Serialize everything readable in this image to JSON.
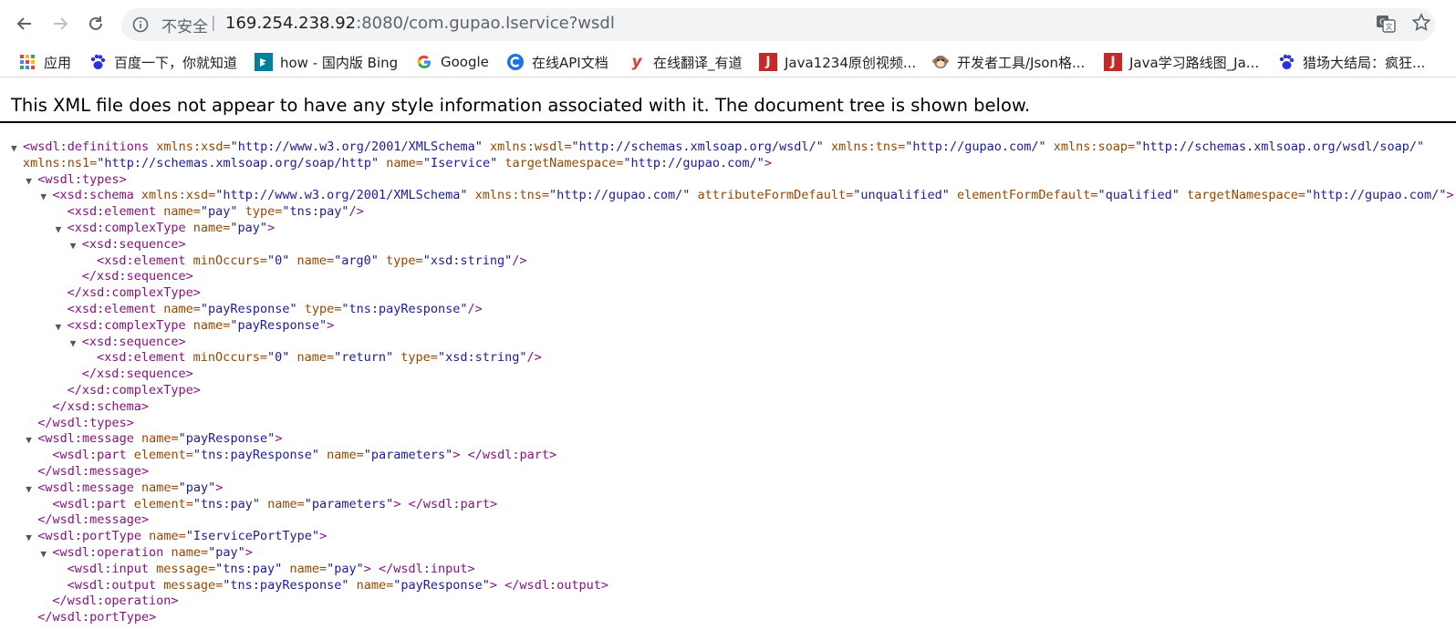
{
  "browser": {
    "insecure_label": "不安全",
    "separator": "|",
    "url_host": "169.254.238.92",
    "url_rest": ":8080/com.gupao.Iservice?wsdl"
  },
  "bookmarks": [
    {
      "label": "应用",
      "icon": "apps-grid-icon"
    },
    {
      "label": "百度一下，你就知道",
      "icon": "baidu-paw-icon"
    },
    {
      "label": "how - 国内版 Bing",
      "icon": "bing-icon"
    },
    {
      "label": "Google",
      "icon": "google-icon"
    },
    {
      "label": "在线API文档",
      "icon": "api-doc-icon"
    },
    {
      "label": "在线翻译_有道",
      "icon": "youdao-icon"
    },
    {
      "label": "Java1234原创视频...",
      "icon": "java1234-icon"
    },
    {
      "label": "开发者工具/Json格...",
      "icon": "monkey-icon"
    },
    {
      "label": "Java学习路线图_Ja...",
      "icon": "java-route-icon"
    },
    {
      "label": "猎场大结局：疯狂...",
      "icon": "baidu-paw-icon"
    }
  ],
  "banner": "This XML file does not appear to have any style information associated with it. The document tree is shown below.",
  "xml_lines": [
    {
      "indent": 0,
      "toggle": true,
      "parts": [
        {
          "t": "tg",
          "v": "<wsdl:definitions"
        },
        {
          "t": "an",
          "v": " xmlns:xsd="
        },
        {
          "t": "av",
          "v": "\"http://www.w3.org/2001/XMLSchema\""
        },
        {
          "t": "an",
          "v": " xmlns:wsdl="
        },
        {
          "t": "av",
          "v": "\"http://schemas.xmlsoap.org/wsdl/\""
        },
        {
          "t": "an",
          "v": " xmlns:tns="
        },
        {
          "t": "av",
          "v": "\"http://gupao.com/\""
        },
        {
          "t": "an",
          "v": " xmlns:soap="
        },
        {
          "t": "av",
          "v": "\"http://schemas.xmlsoap.org/wsdl/soap/\""
        }
      ]
    },
    {
      "indent": 0,
      "toggle": false,
      "cont": true,
      "parts": [
        {
          "t": "an",
          "v": "xmlns:ns1="
        },
        {
          "t": "av",
          "v": "\"http://schemas.xmlsoap.org/soap/http\""
        },
        {
          "t": "an",
          "v": " name="
        },
        {
          "t": "av",
          "v": "\"Iservice\""
        },
        {
          "t": "an",
          "v": " targetNamespace="
        },
        {
          "t": "av",
          "v": "\"http://gupao.com/\""
        },
        {
          "t": "tg",
          "v": ">"
        }
      ]
    },
    {
      "indent": 1,
      "toggle": true,
      "parts": [
        {
          "t": "tg",
          "v": "<wsdl:types>"
        }
      ]
    },
    {
      "indent": 2,
      "toggle": true,
      "parts": [
        {
          "t": "tg",
          "v": "<xsd:schema"
        },
        {
          "t": "an",
          "v": " xmlns:xsd="
        },
        {
          "t": "av",
          "v": "\"http://www.w3.org/2001/XMLSchema\""
        },
        {
          "t": "an",
          "v": " xmlns:tns="
        },
        {
          "t": "av",
          "v": "\"http://gupao.com/\""
        },
        {
          "t": "an",
          "v": " attributeFormDefault="
        },
        {
          "t": "av",
          "v": "\"unqualified\""
        },
        {
          "t": "an",
          "v": " elementFormDefault="
        },
        {
          "t": "av",
          "v": "\"qualified\""
        },
        {
          "t": "an",
          "v": " targetNamespace="
        },
        {
          "t": "av",
          "v": "\"http://gupao.com/\""
        },
        {
          "t": "tg",
          "v": ">"
        }
      ]
    },
    {
      "indent": 3,
      "toggle": false,
      "parts": [
        {
          "t": "tg",
          "v": "<xsd:element"
        },
        {
          "t": "an",
          "v": " name="
        },
        {
          "t": "av",
          "v": "\"pay\""
        },
        {
          "t": "an",
          "v": " type="
        },
        {
          "t": "av",
          "v": "\"tns:pay\""
        },
        {
          "t": "tg",
          "v": "/>"
        }
      ]
    },
    {
      "indent": 3,
      "toggle": true,
      "parts": [
        {
          "t": "tg",
          "v": "<xsd:complexType"
        },
        {
          "t": "an",
          "v": " name="
        },
        {
          "t": "av",
          "v": "\"pay\""
        },
        {
          "t": "tg",
          "v": ">"
        }
      ]
    },
    {
      "indent": 4,
      "toggle": true,
      "parts": [
        {
          "t": "tg",
          "v": "<xsd:sequence>"
        }
      ]
    },
    {
      "indent": 5,
      "toggle": false,
      "parts": [
        {
          "t": "tg",
          "v": "<xsd:element"
        },
        {
          "t": "an",
          "v": " minOccurs="
        },
        {
          "t": "av",
          "v": "\"0\""
        },
        {
          "t": "an",
          "v": " name="
        },
        {
          "t": "av",
          "v": "\"arg0\""
        },
        {
          "t": "an",
          "v": " type="
        },
        {
          "t": "av",
          "v": "\"xsd:string\""
        },
        {
          "t": "tg",
          "v": "/>"
        }
      ]
    },
    {
      "indent": 4,
      "toggle": false,
      "parts": [
        {
          "t": "tg",
          "v": "</xsd:sequence>"
        }
      ]
    },
    {
      "indent": 3,
      "toggle": false,
      "parts": [
        {
          "t": "tg",
          "v": "</xsd:complexType>"
        }
      ]
    },
    {
      "indent": 3,
      "toggle": false,
      "parts": [
        {
          "t": "tg",
          "v": "<xsd:element"
        },
        {
          "t": "an",
          "v": " name="
        },
        {
          "t": "av",
          "v": "\"payResponse\""
        },
        {
          "t": "an",
          "v": " type="
        },
        {
          "t": "av",
          "v": "\"tns:payResponse\""
        },
        {
          "t": "tg",
          "v": "/>"
        }
      ]
    },
    {
      "indent": 3,
      "toggle": true,
      "parts": [
        {
          "t": "tg",
          "v": "<xsd:complexType"
        },
        {
          "t": "an",
          "v": " name="
        },
        {
          "t": "av",
          "v": "\"payResponse\""
        },
        {
          "t": "tg",
          "v": ">"
        }
      ]
    },
    {
      "indent": 4,
      "toggle": true,
      "parts": [
        {
          "t": "tg",
          "v": "<xsd:sequence>"
        }
      ]
    },
    {
      "indent": 5,
      "toggle": false,
      "parts": [
        {
          "t": "tg",
          "v": "<xsd:element"
        },
        {
          "t": "an",
          "v": " minOccurs="
        },
        {
          "t": "av",
          "v": "\"0\""
        },
        {
          "t": "an",
          "v": " name="
        },
        {
          "t": "av",
          "v": "\"return\""
        },
        {
          "t": "an",
          "v": " type="
        },
        {
          "t": "av",
          "v": "\"xsd:string\""
        },
        {
          "t": "tg",
          "v": "/>"
        }
      ]
    },
    {
      "indent": 4,
      "toggle": false,
      "parts": [
        {
          "t": "tg",
          "v": "</xsd:sequence>"
        }
      ]
    },
    {
      "indent": 3,
      "toggle": false,
      "parts": [
        {
          "t": "tg",
          "v": "</xsd:complexType>"
        }
      ]
    },
    {
      "indent": 2,
      "toggle": false,
      "parts": [
        {
          "t": "tg",
          "v": "</xsd:schema>"
        }
      ]
    },
    {
      "indent": 1,
      "toggle": false,
      "parts": [
        {
          "t": "tg",
          "v": "</wsdl:types>"
        }
      ]
    },
    {
      "indent": 1,
      "toggle": true,
      "parts": [
        {
          "t": "tg",
          "v": "<wsdl:message"
        },
        {
          "t": "an",
          "v": " name="
        },
        {
          "t": "av",
          "v": "\"payResponse\""
        },
        {
          "t": "tg",
          "v": ">"
        }
      ]
    },
    {
      "indent": 2,
      "toggle": false,
      "parts": [
        {
          "t": "tg",
          "v": "<wsdl:part"
        },
        {
          "t": "an",
          "v": " element="
        },
        {
          "t": "av",
          "v": "\"tns:payResponse\""
        },
        {
          "t": "an",
          "v": " name="
        },
        {
          "t": "av",
          "v": "\"parameters\""
        },
        {
          "t": "tg",
          "v": "> </wsdl:part>"
        }
      ]
    },
    {
      "indent": 1,
      "toggle": false,
      "parts": [
        {
          "t": "tg",
          "v": "</wsdl:message>"
        }
      ]
    },
    {
      "indent": 1,
      "toggle": true,
      "parts": [
        {
          "t": "tg",
          "v": "<wsdl:message"
        },
        {
          "t": "an",
          "v": " name="
        },
        {
          "t": "av",
          "v": "\"pay\""
        },
        {
          "t": "tg",
          "v": ">"
        }
      ]
    },
    {
      "indent": 2,
      "toggle": false,
      "parts": [
        {
          "t": "tg",
          "v": "<wsdl:part"
        },
        {
          "t": "an",
          "v": " element="
        },
        {
          "t": "av",
          "v": "\"tns:pay\""
        },
        {
          "t": "an",
          "v": " name="
        },
        {
          "t": "av",
          "v": "\"parameters\""
        },
        {
          "t": "tg",
          "v": "> </wsdl:part>"
        }
      ]
    },
    {
      "indent": 1,
      "toggle": false,
      "parts": [
        {
          "t": "tg",
          "v": "</wsdl:message>"
        }
      ]
    },
    {
      "indent": 1,
      "toggle": true,
      "parts": [
        {
          "t": "tg",
          "v": "<wsdl:portType"
        },
        {
          "t": "an",
          "v": " name="
        },
        {
          "t": "av",
          "v": "\"IservicePortType\""
        },
        {
          "t": "tg",
          "v": ">"
        }
      ]
    },
    {
      "indent": 2,
      "toggle": true,
      "parts": [
        {
          "t": "tg",
          "v": "<wsdl:operation"
        },
        {
          "t": "an",
          "v": " name="
        },
        {
          "t": "av",
          "v": "\"pay\""
        },
        {
          "t": "tg",
          "v": ">"
        }
      ]
    },
    {
      "indent": 3,
      "toggle": false,
      "parts": [
        {
          "t": "tg",
          "v": "<wsdl:input"
        },
        {
          "t": "an",
          "v": " message="
        },
        {
          "t": "av",
          "v": "\"tns:pay\""
        },
        {
          "t": "an",
          "v": " name="
        },
        {
          "t": "av",
          "v": "\"pay\""
        },
        {
          "t": "tg",
          "v": "> </wsdl:input>"
        }
      ]
    },
    {
      "indent": 3,
      "toggle": false,
      "parts": [
        {
          "t": "tg",
          "v": "<wsdl:output"
        },
        {
          "t": "an",
          "v": " message="
        },
        {
          "t": "av",
          "v": "\"tns:payResponse\""
        },
        {
          "t": "an",
          "v": " name="
        },
        {
          "t": "av",
          "v": "\"payResponse\""
        },
        {
          "t": "tg",
          "v": "> </wsdl:output>"
        }
      ]
    },
    {
      "indent": 2,
      "toggle": false,
      "parts": [
        {
          "t": "tg",
          "v": "</wsdl:operation>"
        }
      ]
    },
    {
      "indent": 1,
      "toggle": false,
      "parts": [
        {
          "t": "tg",
          "v": "</wsdl:portType>"
        }
      ]
    }
  ]
}
